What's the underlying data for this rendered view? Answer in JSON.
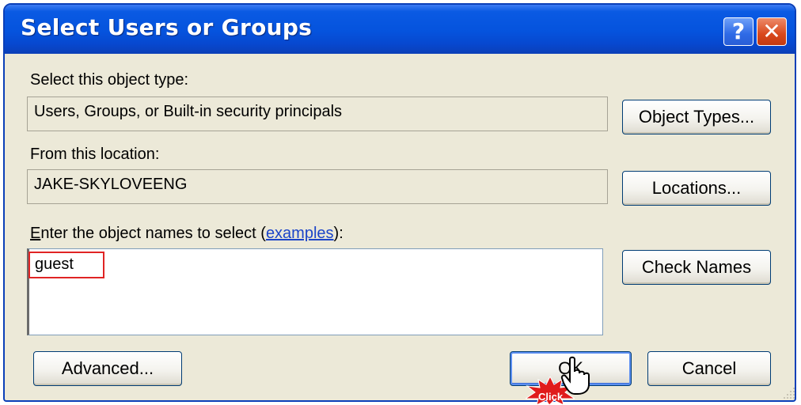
{
  "window": {
    "title": "Select Users or Groups",
    "help_glyph": "?",
    "close_glyph": "✕"
  },
  "object_type": {
    "label": "Select this object type:",
    "value": "Users, Groups, or Built-in security principals",
    "button": "Object Types..."
  },
  "location": {
    "label": "From this location:",
    "value": "JAKE-SKYLOVEENG",
    "button": "Locations..."
  },
  "names": {
    "label_prefix_mnemonic": "E",
    "label_prefix_rest": "nter the object names to select (",
    "label_link": "examples",
    "label_suffix": "):",
    "value": "guest",
    "button": "Check Names"
  },
  "footer": {
    "advanced": "Advanced...",
    "ok": "OK",
    "cancel": "Cancel"
  },
  "annotation": {
    "click_label": "Click",
    "highlight_color": "#e02424"
  },
  "icons": {
    "help": "help-icon",
    "close": "close-icon",
    "cursor": "hand-pointer-icon",
    "grip": "resize-grip-icon"
  }
}
